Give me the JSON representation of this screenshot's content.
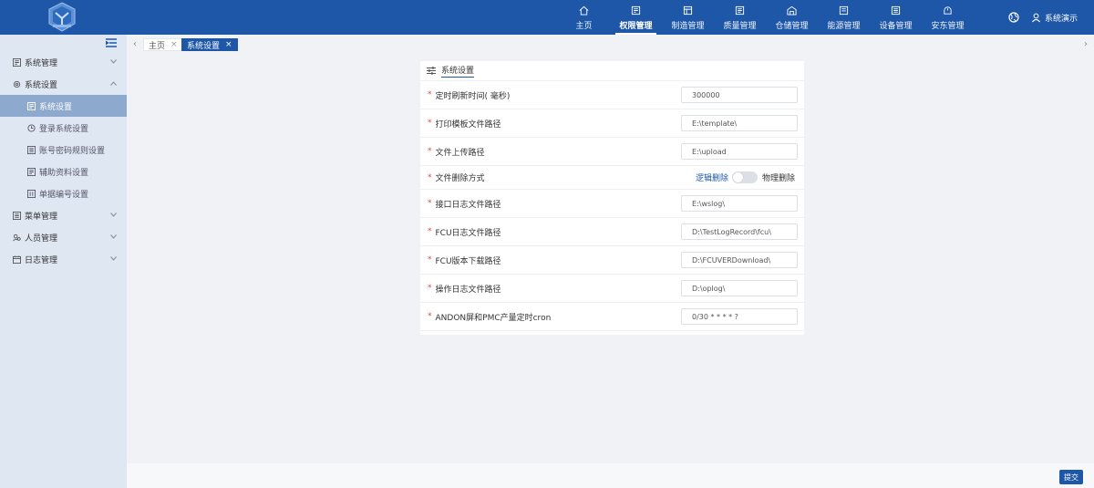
{
  "header": {
    "nav": [
      {
        "label": "主页",
        "icon": "home-icon",
        "active": false
      },
      {
        "label": "权限管理",
        "icon": "permission-icon",
        "active": true
      },
      {
        "label": "制造管理",
        "icon": "manufacture-icon",
        "active": false
      },
      {
        "label": "质量管理",
        "icon": "quality-icon",
        "active": false
      },
      {
        "label": "仓储管理",
        "icon": "warehouse-icon",
        "active": false
      },
      {
        "label": "能源管理",
        "icon": "energy-icon",
        "active": false
      },
      {
        "label": "设备管理",
        "icon": "equipment-icon",
        "active": false
      },
      {
        "label": "安东管理",
        "icon": "andon-icon",
        "active": false
      }
    ],
    "user_label": "系统演示"
  },
  "sidebar": {
    "menu": [
      {
        "label": "系统管理",
        "icon": "system-manage-icon",
        "expanded": false
      },
      {
        "label": "系统设置",
        "icon": "gear-icon",
        "expanded": true
      },
      {
        "label": "菜单管理",
        "icon": "menu-manage-icon",
        "expanded": false
      },
      {
        "label": "人员管理",
        "icon": "users-icon",
        "expanded": false
      },
      {
        "label": "日志管理",
        "icon": "log-icon",
        "expanded": false
      }
    ],
    "submenu": [
      {
        "label": "系统设置",
        "active": true
      },
      {
        "label": "登录系统设置",
        "active": false
      },
      {
        "label": "账号密码规则设置",
        "active": false
      },
      {
        "label": "辅助资料设置",
        "active": false
      },
      {
        "label": "单据编号设置",
        "active": false
      }
    ]
  },
  "tabs": [
    {
      "label": "主页",
      "close": "×"
    },
    {
      "label": "系统设置",
      "close": "×"
    }
  ],
  "panel": {
    "title": "系统设置",
    "rows": [
      {
        "label": "定时刷新时间( 毫秒)",
        "value": "300000"
      },
      {
        "label": "打印模板文件路径",
        "value": "E:\\template\\"
      },
      {
        "label": "文件上传路径",
        "value": "E:\\upload"
      },
      {
        "label": "文件删除方式",
        "toggle_left": "逻辑删除",
        "toggle_right": "物理删除"
      },
      {
        "label": "接口日志文件路径",
        "value": "E:\\wslog\\"
      },
      {
        "label": "FCU日志文件路径",
        "value": "D:\\TestLogRecord\\fcu\\"
      },
      {
        "label": "FCU版本下载路径",
        "value": "D:\\FCUVERDownload\\"
      },
      {
        "label": "操作日志文件路径",
        "value": "D:\\oplog\\"
      },
      {
        "label": "ANDON屏和PMC产量定时cron",
        "value": "0/30 * * * * ?"
      }
    ],
    "required_mark": "*"
  },
  "footer": {
    "submit_label": "提交"
  },
  "colors": {
    "primary": "#1f57a8",
    "sidebar_bg": "#dfe7f3",
    "active_sub": "#8ea9ce",
    "required": "#e0454b"
  }
}
